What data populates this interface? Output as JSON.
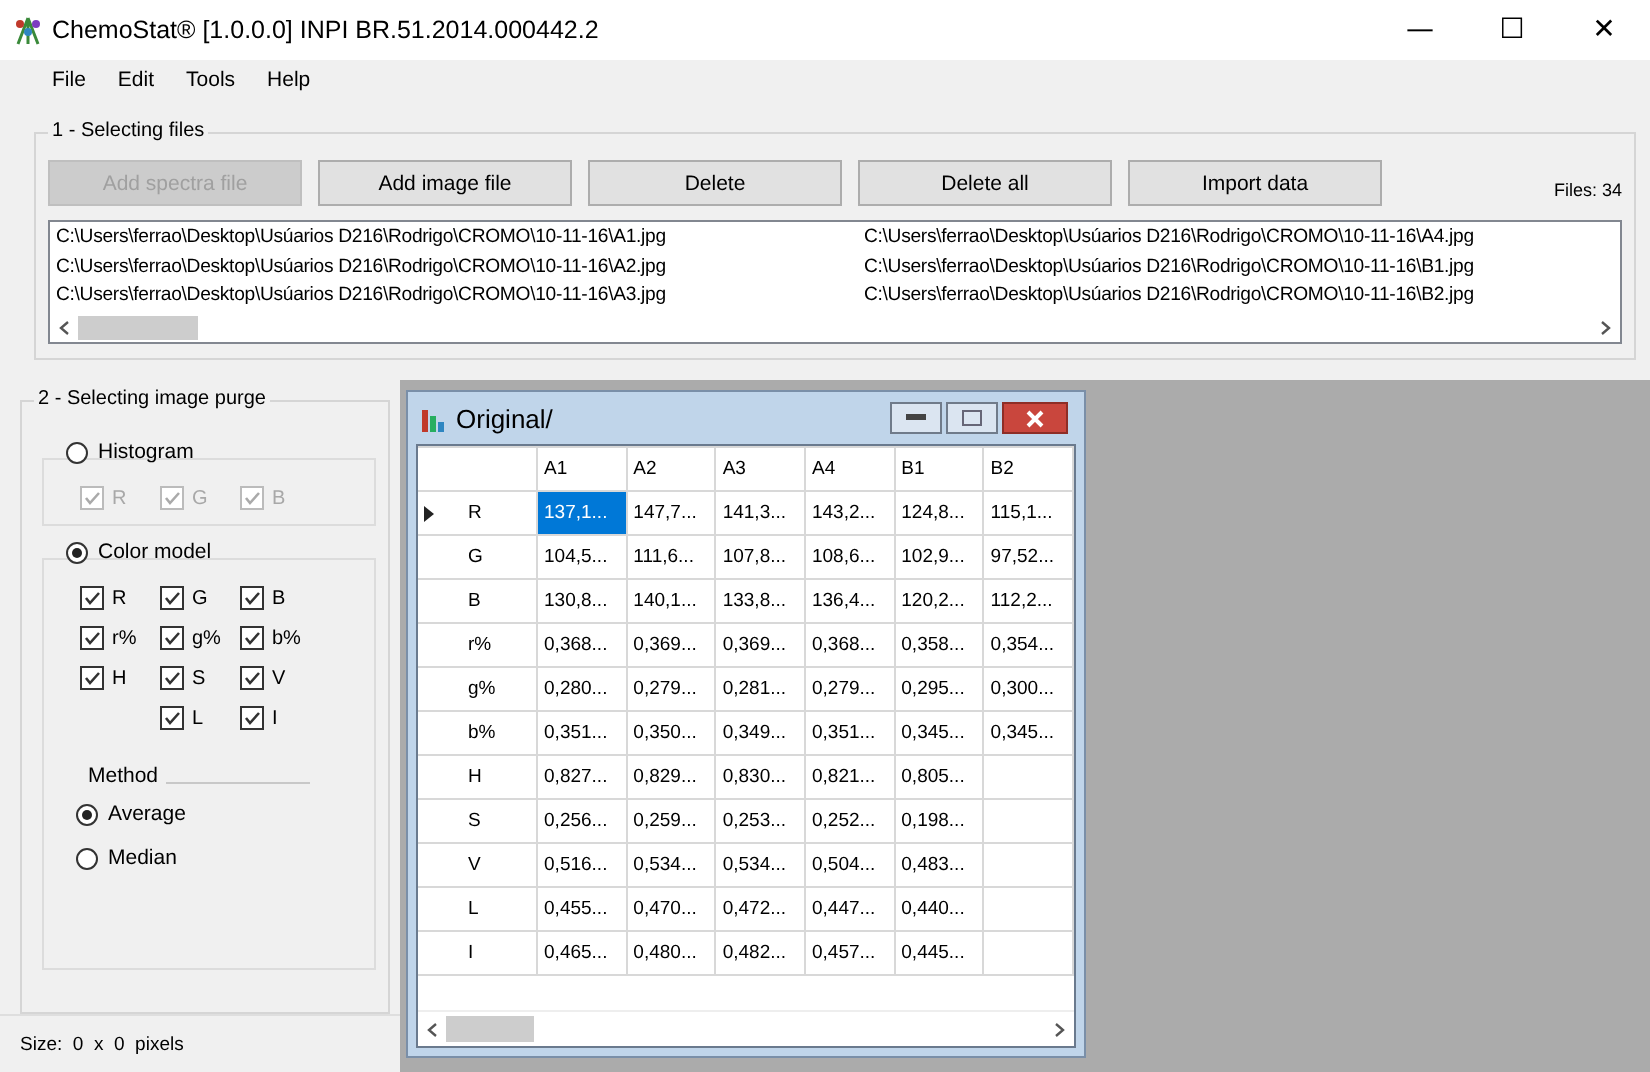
{
  "window": {
    "title": "ChemoStat® [1.0.0.0] INPI BR.51.2014.000442.2",
    "controls": [
      "—",
      "☐",
      "✕"
    ]
  },
  "menu": [
    "File",
    "Edit",
    "Tools",
    "Help"
  ],
  "files_group": {
    "title": "1 - Selecting files",
    "buttons": [
      {
        "label": "Add spectra file",
        "disabled": true
      },
      {
        "label": "Add image file",
        "disabled": false
      },
      {
        "label": "Delete",
        "disabled": false
      },
      {
        "label": "Delete all",
        "disabled": false
      },
      {
        "label": "Import data",
        "disabled": false
      }
    ],
    "count": "Files: 34",
    "files": [
      "C:\\Users\\ferrao\\Desktop\\Usúarios D216\\Rodrigo\\CROMO\\10-11-16\\A1.jpg",
      "C:\\Users\\ferrao\\Desktop\\Usúarios D216\\Rodrigo\\CROMO\\10-11-16\\A2.jpg",
      "C:\\Users\\ferrao\\Desktop\\Usúarios D216\\Rodrigo\\CROMO\\10-11-16\\A3.jpg",
      "C:\\Users\\ferrao\\Desktop\\Usúarios D216\\Rodrigo\\CROMO\\10-11-16\\A4.jpg",
      "C:\\Users\\ferrao\\Desktop\\Usúarios D216\\Rodrigo\\CROMO\\10-11-16\\B1.jpg",
      "C:\\Users\\ferrao\\Desktop\\Usúarios D216\\Rodrigo\\CROMO\\10-11-16\\B2.jpg"
    ]
  },
  "purge_group": {
    "title": "2 - Selecting image purge",
    "modes": [
      {
        "label": "Histogram",
        "selected": false,
        "disabled": true,
        "checks": [
          {
            "label": "R",
            "checked": true
          },
          {
            "label": "G",
            "checked": true
          },
          {
            "label": "B",
            "checked": true
          }
        ]
      },
      {
        "label": "Color model",
        "selected": true,
        "disabled": false,
        "checks": [
          {
            "label": "R",
            "checked": true
          },
          {
            "label": "G",
            "checked": true
          },
          {
            "label": "B",
            "checked": true
          },
          {
            "label": "r%",
            "checked": true
          },
          {
            "label": "g%",
            "checked": true
          },
          {
            "label": "b%",
            "checked": true
          },
          {
            "label": "H",
            "checked": true
          },
          {
            "label": "S",
            "checked": true
          },
          {
            "label": "V",
            "checked": true
          },
          {
            "label": "L",
            "checked": true
          },
          {
            "label": "I",
            "checked": true
          }
        ]
      }
    ],
    "method": {
      "title": "Method",
      "options": [
        {
          "label": "Average",
          "selected": true
        },
        {
          "label": "Median",
          "selected": false
        }
      ]
    }
  },
  "status_bar": "Size:  0  x  0  pixels",
  "child_window": {
    "title": "Original/",
    "columns": [
      "A1",
      "A2",
      "A3",
      "A4",
      "B1",
      "B2"
    ],
    "rows": [
      {
        "header": "R",
        "current": true,
        "cells": [
          {
            "text": "137,1...",
            "selected": true
          },
          {
            "text": "147,7...",
            "selected": false
          },
          {
            "text": "141,3...",
            "selected": false
          },
          {
            "text": "143,2...",
            "selected": false
          },
          {
            "text": "124,8...",
            "selected": false
          },
          {
            "text": "115,1...",
            "selected": false
          }
        ]
      },
      {
        "header": "G",
        "current": false,
        "cells": [
          {
            "text": "104,5...",
            "selected": false
          },
          {
            "text": "111,6...",
            "selected": false
          },
          {
            "text": "107,8...",
            "selected": false
          },
          {
            "text": "108,6...",
            "selected": false
          },
          {
            "text": "102,9...",
            "selected": false
          },
          {
            "text": "97,52...",
            "selected": false
          }
        ]
      },
      {
        "header": "B",
        "current": false,
        "cells": [
          {
            "text": "130,8...",
            "selected": false
          },
          {
            "text": "140,1...",
            "selected": false
          },
          {
            "text": "133,8...",
            "selected": false
          },
          {
            "text": "136,4...",
            "selected": false
          },
          {
            "text": "120,2...",
            "selected": false
          },
          {
            "text": "112,2...",
            "selected": false
          }
        ]
      },
      {
        "header": "r%",
        "current": false,
        "cells": [
          {
            "text": "0,368...",
            "selected": false
          },
          {
            "text": "0,369...",
            "selected": false
          },
          {
            "text": "0,369...",
            "selected": false
          },
          {
            "text": "0,368...",
            "selected": false
          },
          {
            "text": "0,358...",
            "selected": false
          },
          {
            "text": "0,354...",
            "selected": false
          }
        ]
      },
      {
        "header": "g%",
        "current": false,
        "cells": [
          {
            "text": "0,280...",
            "selected": false
          },
          {
            "text": "0,279...",
            "selected": false
          },
          {
            "text": "0,281...",
            "selected": false
          },
          {
            "text": "0,279...",
            "selected": false
          },
          {
            "text": "0,295...",
            "selected": false
          },
          {
            "text": "0,300...",
            "selected": false
          }
        ]
      },
      {
        "header": "b%",
        "current": false,
        "cells": [
          {
            "text": "0,351...",
            "selected": false
          },
          {
            "text": "0,350...",
            "selected": false
          },
          {
            "text": "0,349...",
            "selected": false
          },
          {
            "text": "0,351...",
            "selected": false
          },
          {
            "text": "0,345...",
            "selected": false
          },
          {
            "text": "0,345...",
            "selected": false
          }
        ]
      },
      {
        "header": "H",
        "current": false,
        "cells": [
          {
            "text": "0,827...",
            "selected": false
          },
          {
            "text": "0,829...",
            "selected": false
          },
          {
            "text": "0,830...",
            "selected": false
          },
          {
            "text": "0,821...",
            "selected": false
          },
          {
            "text": "0,805...",
            "selected": false
          }
        ]
      },
      {
        "header": "S",
        "current": false,
        "cells": [
          {
            "text": "0,256...",
            "selected": false
          },
          {
            "text": "0,259...",
            "selected": false
          },
          {
            "text": "0,253...",
            "selected": false
          },
          {
            "text": "0,252...",
            "selected": false
          },
          {
            "text": "0,198...",
            "selected": false
          }
        ]
      },
      {
        "header": "V",
        "current": false,
        "cells": [
          {
            "text": "0,516...",
            "selected": false
          },
          {
            "text": "0,534...",
            "selected": false
          },
          {
            "text": "0,534...",
            "selected": false
          },
          {
            "text": "0,504...",
            "selected": false
          },
          {
            "text": "0,483...",
            "selected": false
          }
        ]
      },
      {
        "header": "L",
        "current": false,
        "cells": [
          {
            "text": "0,455...",
            "selected": false
          },
          {
            "text": "0,470...",
            "selected": false
          },
          {
            "text": "0,472...",
            "selected": false
          },
          {
            "text": "0,447...",
            "selected": false
          },
          {
            "text": "0,440...",
            "selected": false
          }
        ]
      },
      {
        "header": "I",
        "current": false,
        "cells": [
          {
            "text": "0,465...",
            "selected": false
          },
          {
            "text": "0,480...",
            "selected": false
          },
          {
            "text": "0,482...",
            "selected": false
          },
          {
            "text": "0,457...",
            "selected": false
          },
          {
            "text": "0,445...",
            "selected": false
          }
        ]
      }
    ]
  }
}
